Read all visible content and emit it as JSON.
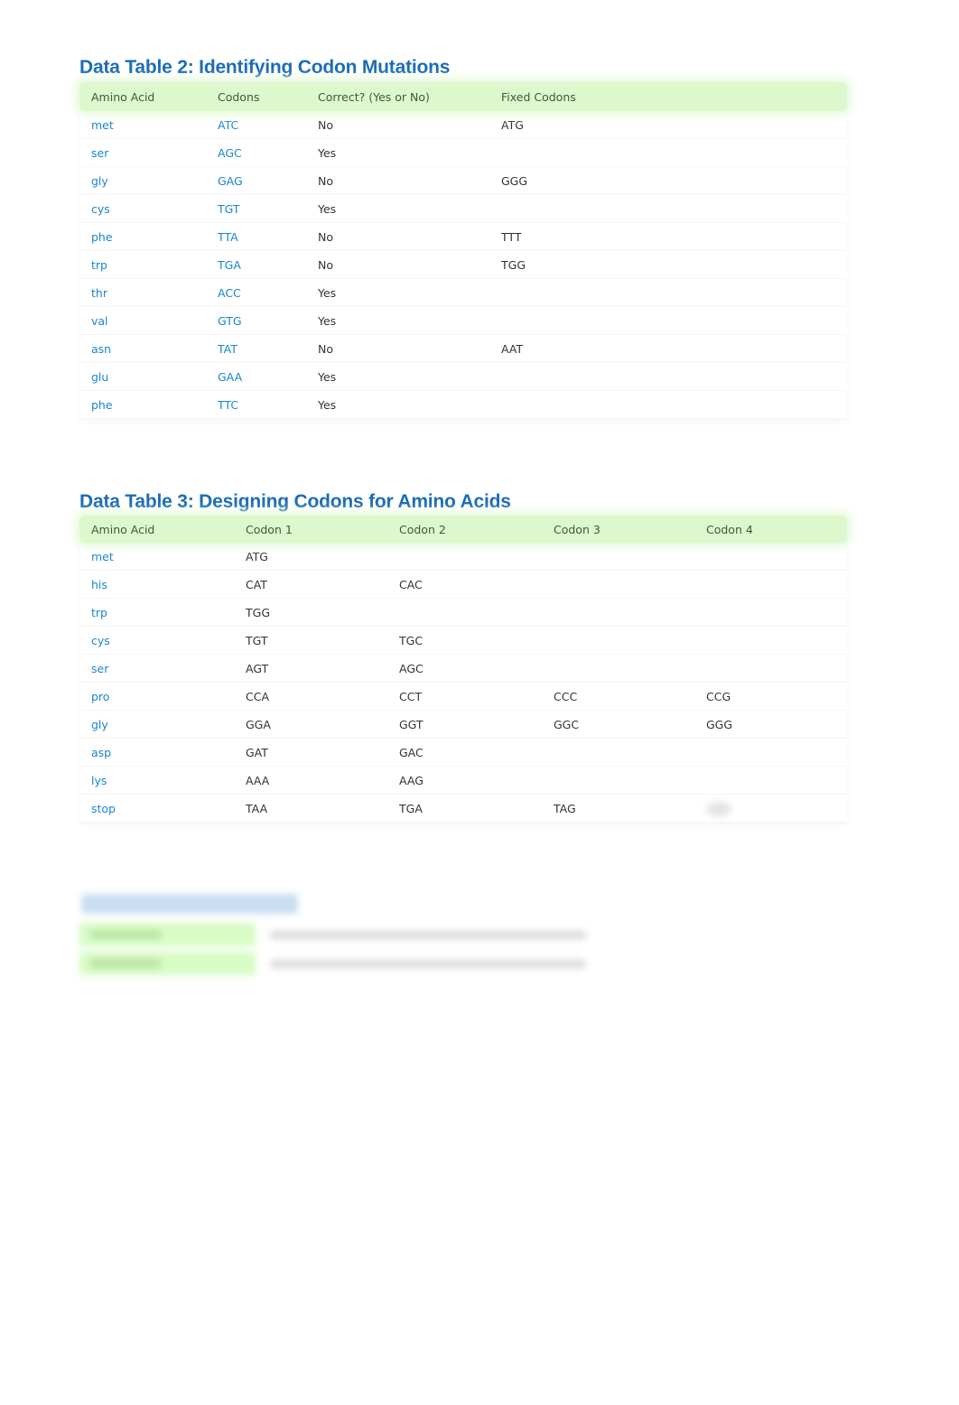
{
  "table2": {
    "title": "Data Table 2: Identifying Codon Mutations",
    "headers": [
      "Amino Acid",
      "Codons",
      "Correct? (Yes or No)",
      "Fixed Codons"
    ],
    "rows": [
      {
        "amino_acid": "met",
        "codon": "ATC",
        "correct": "No",
        "fixed": "ATG"
      },
      {
        "amino_acid": "ser",
        "codon": "AGC",
        "correct": "Yes",
        "fixed": ""
      },
      {
        "amino_acid": "gly",
        "codon": "GAG",
        "correct": "No",
        "fixed": "GGG"
      },
      {
        "amino_acid": "cys",
        "codon": "TGT",
        "correct": "Yes",
        "fixed": ""
      },
      {
        "amino_acid": "phe",
        "codon": "TTA",
        "correct": "No",
        "fixed": "TTT"
      },
      {
        "amino_acid": "trp",
        "codon": "TGA",
        "correct": "No",
        "fixed": "TGG"
      },
      {
        "amino_acid": "thr",
        "codon": "ACC",
        "correct": "Yes",
        "fixed": ""
      },
      {
        "amino_acid": "val",
        "codon": "GTG",
        "correct": "Yes",
        "fixed": ""
      },
      {
        "amino_acid": "asn",
        "codon": "TAT",
        "correct": "No",
        "fixed": "AAT"
      },
      {
        "amino_acid": "glu",
        "codon": "GAA",
        "correct": "Yes",
        "fixed": ""
      },
      {
        "amino_acid": "phe",
        "codon": "TTC",
        "correct": "Yes",
        "fixed": ""
      }
    ]
  },
  "table3": {
    "title": "Data Table 3: Designing Codons for Amino Acids",
    "headers": [
      "Amino Acid",
      "Codon 1",
      "Codon 2",
      "Codon 3",
      "Codon 4"
    ],
    "rows": [
      {
        "amino_acid": "met",
        "codons": [
          "ATG",
          "",
          "",
          ""
        ]
      },
      {
        "amino_acid": "his",
        "codons": [
          "CAT",
          "CAC",
          "",
          ""
        ]
      },
      {
        "amino_acid": "trp",
        "codons": [
          "TGG",
          "",
          "",
          ""
        ]
      },
      {
        "amino_acid": "cys",
        "codons": [
          "TGT",
          "TGC",
          "",
          ""
        ]
      },
      {
        "amino_acid": "ser",
        "codons": [
          "AGT",
          "AGC",
          "",
          ""
        ]
      },
      {
        "amino_acid": "pro",
        "codons": [
          "CCA",
          "CCT",
          "CCC",
          "CCG"
        ]
      },
      {
        "amino_acid": "gly",
        "codons": [
          "GGA",
          "GGT",
          "GGC",
          "GGG"
        ]
      },
      {
        "amino_acid": "asp",
        "codons": [
          "GAT",
          "GAC",
          "",
          ""
        ]
      },
      {
        "amino_acid": "lys",
        "codons": [
          "AAA",
          "AAG",
          "",
          ""
        ]
      },
      {
        "amino_acid": "stop",
        "codons": [
          "TAA",
          "TGA",
          "TAG",
          ""
        ]
      }
    ]
  },
  "blurred_section": {
    "rows": 2
  },
  "colors": {
    "title_blue": "#1b6cb5",
    "amino_acid_blue": "#1a86d0",
    "header_green": "#ddf8cd",
    "header_text": "#3c5a3c",
    "body_text": "#333333"
  }
}
